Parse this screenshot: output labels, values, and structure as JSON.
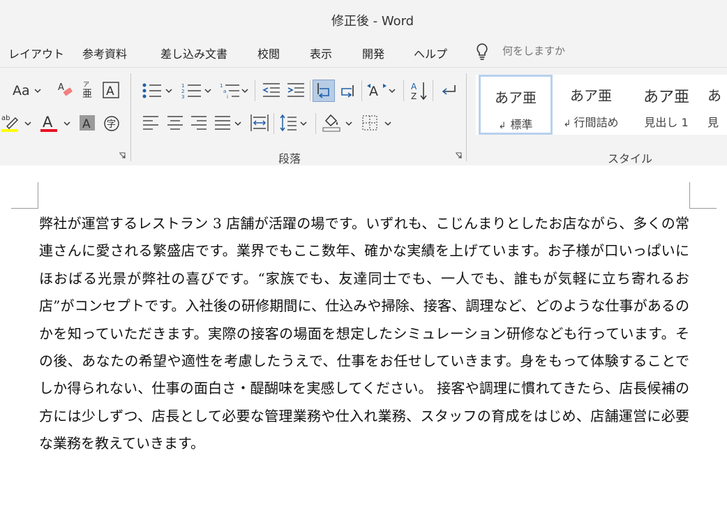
{
  "window": {
    "title": "修正後 - Word"
  },
  "tabs": [
    {
      "label": "レイアウト"
    },
    {
      "label": "参考資料"
    },
    {
      "label": "差し込み文書"
    },
    {
      "label": "校閲"
    },
    {
      "label": "表示"
    },
    {
      "label": "開発"
    },
    {
      "label": "ヘルプ"
    }
  ],
  "tell_me": {
    "placeholder": "何をしますか"
  },
  "font_group": {
    "change_case_label": "Aa",
    "highlight_color": "#ffff00",
    "font_color": "#e81123"
  },
  "paragraph_group": {
    "label": "段落"
  },
  "styles_group": {
    "label": "スタイル",
    "items": [
      {
        "preview": "あア亜",
        "name": "標準",
        "mark": "↲"
      },
      {
        "preview": "あア亜",
        "name": "行間詰め",
        "mark": "↲"
      },
      {
        "preview": "あア亜",
        "name": "見出し 1",
        "mark": ""
      },
      {
        "preview": "あ",
        "name": "見",
        "mark": ""
      }
    ]
  },
  "document": {
    "body": "弊社が運営するレストラン 3 店舗が活躍の場です。いずれも、こじんまりとしたお店ながら、多くの常連さんに愛される繁盛店です。業界でもここ数年、確かな実績を上げています。お子様が口いっぱいにほおばる光景が弊社の喜びです。“家族でも、友達同士でも、一人でも、誰もが気軽に立ち寄れるお店”がコンセプトです。入社後の研修期間に、仕込みや掃除、接客、調理など、どのような仕事があるのかを知っていただきます。実際の接客の場面を想定したシミュレーション研修なども行っています。その後、あなたの希望や適性を考慮したうえで、仕事をお任せしていきます。身をもって体験することでしか得られない、仕事の面白さ・醍醐味を実感してください。 接客や調理に慣れてきたら、店長候補の方には少しずつ、店長として必要な管理業務や仕入れ業務、スタッフの育成をはじめ、店舗運営に必要な業務を教えていきます。"
  }
}
